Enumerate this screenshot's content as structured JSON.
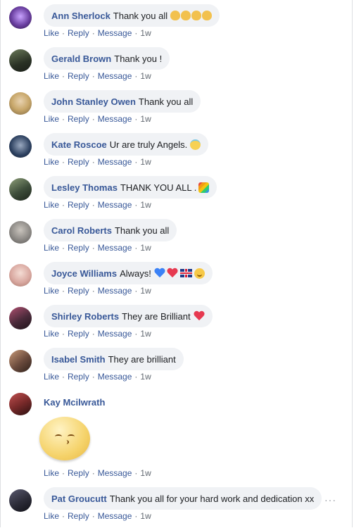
{
  "actions": {
    "like": "Like",
    "reply": "Reply",
    "message": "Message",
    "sep": "·"
  },
  "comments": [
    {
      "name": "Ann Sherlock",
      "text": "Thank you all",
      "time": "1w"
    },
    {
      "name": "Gerald Brown",
      "text": "Thank you !",
      "time": "1w"
    },
    {
      "name": "John Stanley Owen",
      "text": "Thank you all",
      "time": "1w"
    },
    {
      "name": "Kate Roscoe",
      "text": "Ur are truly Angels.",
      "time": "1w"
    },
    {
      "name": "Lesley Thomas",
      "text": "THANK YOU ALL .",
      "time": "1w"
    },
    {
      "name": "Carol Roberts",
      "text": "Thank you all",
      "time": "1w"
    },
    {
      "name": "Joyce Williams",
      "text": "Always!",
      "time": "1w"
    },
    {
      "name": "Shirley Roberts",
      "text": "They are Brilliant",
      "time": "1w"
    },
    {
      "name": "Isabel Smith",
      "text": "They are brilliant",
      "time": "1w"
    },
    {
      "name": "Kay Mcilwrath",
      "text": "",
      "time": "1w",
      "sticker": "smiling-face-sticker"
    },
    {
      "name": "Pat Groucutt",
      "text": "Thank you all for your hard work and dedication xx",
      "time": "1w"
    }
  ],
  "more_icon": "···",
  "avatar_colors": [
    "#6a3fa0",
    "#3c4a3a",
    "#c8a76a",
    "#2b3f5e",
    "#3d4d3a",
    "#8d8a86",
    "#d9a8a0",
    "#4a2a3a",
    "#6a4a3c",
    "#7a2a2a",
    "#2c2c38"
  ]
}
